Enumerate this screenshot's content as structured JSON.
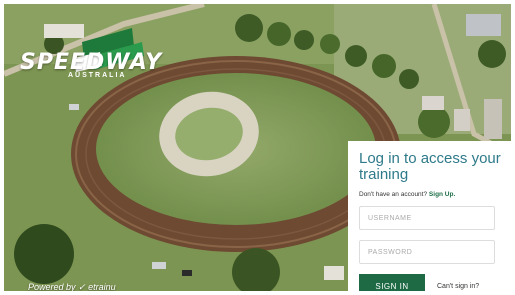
{
  "brand": {
    "name": "SPEEDWAY",
    "sub": "AUSTRALIA",
    "powered_by": "Powered by  ✓ etrainu"
  },
  "login": {
    "title": "Log in to access your training",
    "signup_prompt": "Don't have an account?",
    "signup_link": "Sign Up.",
    "username_placeholder": "USERNAME",
    "password_placeholder": "PASSWORD",
    "signin_label": "SIGN IN",
    "cant_signin_label": "Can't sign in?"
  },
  "colors": {
    "accent_teal": "#2f7a8a",
    "button_green": "#1d6a45"
  }
}
